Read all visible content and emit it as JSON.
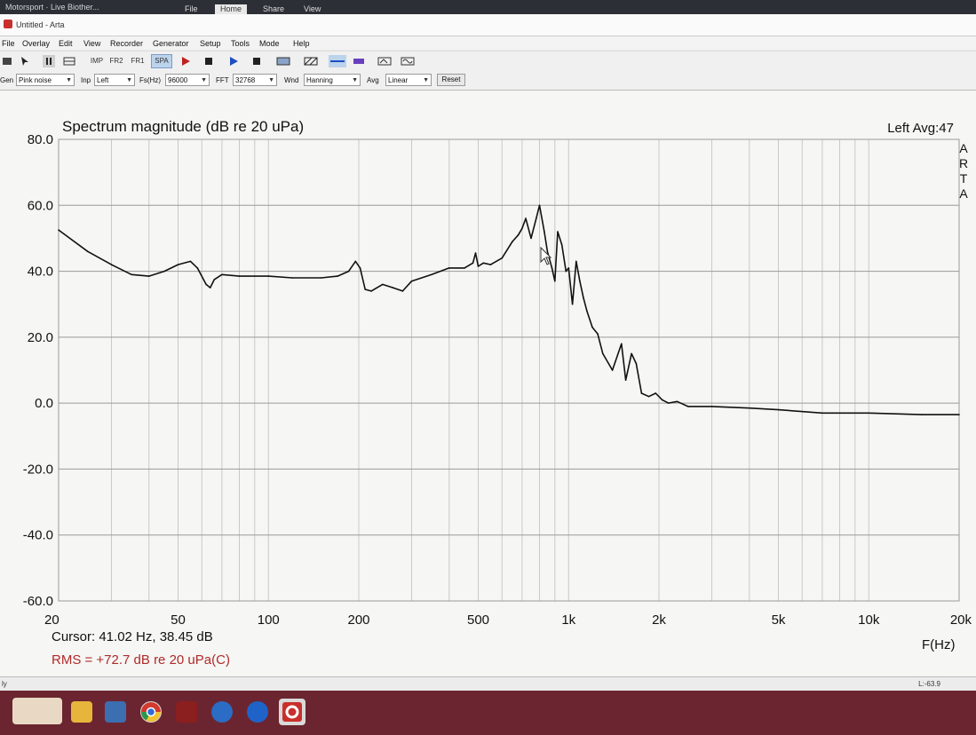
{
  "top": {
    "app_label": "Motorsport · Live Biother...",
    "tabs": [
      "File",
      "Home",
      "Share",
      "View"
    ]
  },
  "window": {
    "title": "Untitled - Arta"
  },
  "menu": [
    "File",
    "Overlay",
    "Edit",
    "View",
    "Recorder",
    "Generator",
    "Setup",
    "Tools",
    "Mode",
    "Help"
  ],
  "toolbar": {
    "buttons": [
      "IMP",
      "FR2",
      "FR1",
      "SPA"
    ]
  },
  "options": {
    "gen_label": "Gen",
    "gen_value": "Pink noise",
    "inp_label": "Inp",
    "inp_value": "Left",
    "fs_label": "Fs(Hz)",
    "fs_value": "96000",
    "fft_label": "FFT",
    "fft_value": "32768",
    "wnd_label": "Wnd",
    "wnd_value": "Hanning",
    "avg_label": "Avg",
    "avg_value": "Linear",
    "reset_label": "Reset"
  },
  "plot": {
    "status_right": "Left  Avg:47",
    "brand_letters": [
      "A",
      "R",
      "T",
      "A"
    ],
    "cursor_text": "Cursor: 41.02 Hz, 38.45 dB",
    "rms_text": "RMS =  +72.7 dB re 20 uPa(C)"
  },
  "statusbar": {
    "left": "ly",
    "right": "L:-63.9"
  },
  "colors": {
    "trace": "#111111",
    "rms": "#b02a2a",
    "grid": "#c9c9c9",
    "plot_bg": "#f6f6f4"
  },
  "chart_data": {
    "type": "line",
    "title": "Spectrum magnitude (dB re 20 uPa)",
    "xlabel": "F(Hz)",
    "ylabel": "",
    "x_scale": "log",
    "xlim": [
      20,
      20000
    ],
    "ylim": [
      -60,
      80
    ],
    "y_ticks": [
      "80.0",
      "60.0",
      "40.0",
      "20.0",
      "0.0",
      "-20.0",
      "-40.0",
      "-60.0"
    ],
    "y_tick_values": [
      80,
      60,
      40,
      20,
      0,
      -20,
      -40,
      -60
    ],
    "x_ticks": [
      "20",
      "50",
      "100",
      "200",
      "500",
      "1k",
      "2k",
      "5k",
      "10k",
      "20k"
    ],
    "x_tick_values": [
      20,
      50,
      100,
      200,
      500,
      1000,
      2000,
      5000,
      10000,
      20000
    ],
    "grid": true,
    "series": [
      {
        "x": [
          20,
          25,
          30,
          35,
          40,
          45,
          50,
          55,
          58,
          62,
          64,
          66,
          70,
          80,
          100,
          120,
          150,
          170,
          185,
          195,
          202,
          210,
          220,
          240,
          260,
          280,
          300,
          350,
          400,
          450,
          480,
          490,
          500,
          520,
          550,
          600,
          650,
          680,
          700,
          720,
          750,
          780,
          800,
          830,
          850,
          880,
          900,
          920,
          950,
          980,
          1000,
          1030,
          1060,
          1090,
          1120,
          1150,
          1200,
          1250,
          1300,
          1400,
          1500,
          1550,
          1620,
          1680,
          1750,
          1850,
          1950,
          2050,
          2150,
          2300,
          2500,
          3000,
          4000,
          5000,
          7000,
          10000,
          15000,
          20000
        ],
        "y": [
          52.5,
          46,
          42,
          39,
          38.5,
          40,
          42,
          43,
          41,
          36,
          35,
          37.5,
          39,
          38.5,
          38.5,
          38,
          38,
          38.5,
          40,
          43,
          41,
          34.5,
          34,
          36,
          35,
          34,
          37,
          39,
          41,
          41,
          42.5,
          45.5,
          41.5,
          42.5,
          42,
          44,
          49,
          51,
          53,
          56,
          50,
          56,
          60,
          52,
          46,
          41,
          37,
          52,
          48,
          40,
          41,
          30,
          43,
          37,
          32,
          28,
          23,
          21,
          15,
          10,
          18,
          7,
          15,
          12,
          3,
          2,
          3,
          1,
          0,
          0.5,
          -1,
          -1,
          -1.5,
          -2,
          -3,
          -3,
          -3.5,
          -3.5
        ]
      }
    ]
  }
}
